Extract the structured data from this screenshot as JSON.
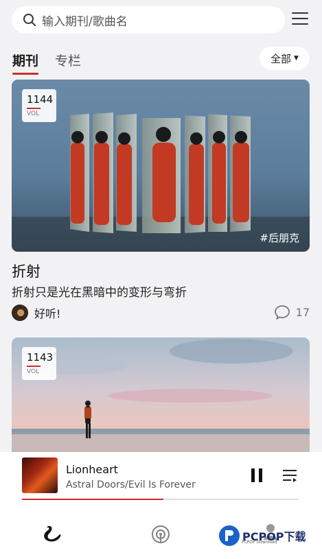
{
  "search": {
    "placeholder": "输入期刊/歌曲名"
  },
  "tabs": [
    {
      "label": "期刊"
    },
    {
      "label": "专栏"
    }
  ],
  "filter": {
    "label": "全部"
  },
  "cards": [
    {
      "vol": "1144",
      "vol_label": "VOL",
      "tag": "#后朋克",
      "title": "折射",
      "desc": "折射只是光在黑暗中的变形与弯折",
      "author": "好听!",
      "comments": "17"
    },
    {
      "vol": "1143",
      "vol_label": "VOL"
    }
  ],
  "player": {
    "title": "Lionheart",
    "artist": "Astral Doors/Evil Is Forever",
    "progress": 0.51
  },
  "watermark": {
    "text": "PCPOP下载",
    "sub": "PCPOP Download"
  },
  "icons": [
    "search-icon",
    "menu-icon",
    "comment-icon",
    "pause-icon",
    "queue-icon",
    "swan-icon",
    "radio-icon",
    "user-icon"
  ],
  "colors": {
    "accent": "#c8302c",
    "background": "#f2f2f4"
  }
}
